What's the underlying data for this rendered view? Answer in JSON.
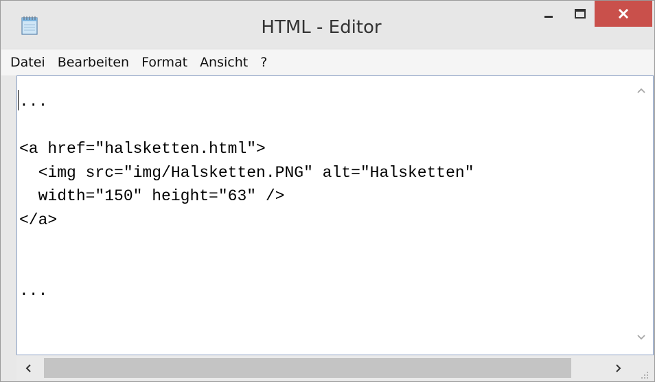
{
  "window": {
    "title": "HTML - Editor",
    "controls": {
      "minimize": "minimize-icon",
      "maximize": "maximize-icon",
      "close": "close-icon"
    }
  },
  "menu": {
    "items": [
      "Datei",
      "Bearbeiten",
      "Format",
      "Ansicht",
      "?"
    ]
  },
  "editor": {
    "content": "...\n\n<a href=\"halsketten.html\">\n  <img src=\"img/Halsketten.PNG\" alt=\"Halsketten\"\n  width=\"150\" height=\"63\" />\n</a>\n\n\n..."
  },
  "colors": {
    "close_button": "#c9504b",
    "editor_border": "#8aa0c4",
    "scroll_thumb": "#c4c4c4"
  }
}
